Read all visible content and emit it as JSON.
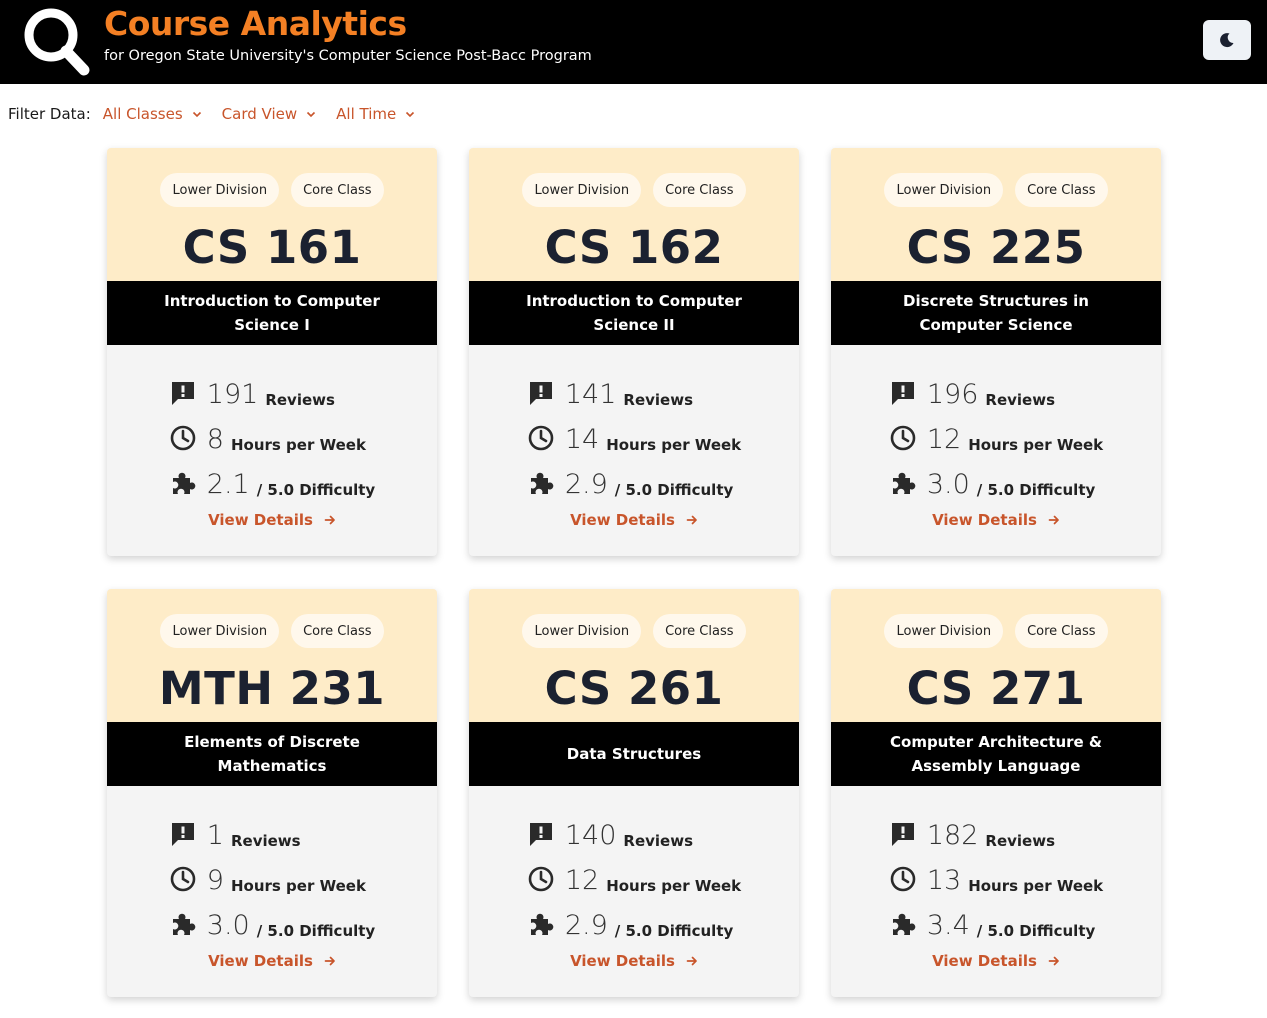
{
  "header": {
    "title": "Course Analytics",
    "subtitle": "for Oregon State University's Computer Science Post-Bacc Program",
    "logo_icon": "search-icon",
    "theme_icon": "moon-icon"
  },
  "filters": {
    "label": "Filter Data:",
    "classes": "All Classes",
    "view": "Card View",
    "time": "All Time"
  },
  "colors": {
    "accent": "#c8552b",
    "title": "#f48024",
    "card_top": "#feecc8",
    "card_body": "#f4f4f4"
  },
  "labels": {
    "reviews": "Reviews",
    "hours": "Hours per Week",
    "difficulty": "/ 5.0 Difficulty",
    "view_details": "View Details"
  },
  "cards": [
    {
      "tags": [
        "Lower Division",
        "Core Class"
      ],
      "code": "CS 161",
      "name": "Introduction to Computer Science I",
      "reviews": "191",
      "hours": "8",
      "difficulty": "2.1"
    },
    {
      "tags": [
        "Lower Division",
        "Core Class"
      ],
      "code": "CS 162",
      "name": "Introduction to Computer Science II",
      "reviews": "141",
      "hours": "14",
      "difficulty": "2.9"
    },
    {
      "tags": [
        "Lower Division",
        "Core Class"
      ],
      "code": "CS 225",
      "name": "Discrete Structures in Computer Science",
      "reviews": "196",
      "hours": "12",
      "difficulty": "3.0"
    },
    {
      "tags": [
        "Lower Division",
        "Core Class"
      ],
      "code": "MTH 231",
      "name": "Elements of Discrete Mathematics",
      "reviews": "1",
      "hours": "9",
      "difficulty": "3.0"
    },
    {
      "tags": [
        "Lower Division",
        "Core Class"
      ],
      "code": "CS 261",
      "name": "Data Structures",
      "reviews": "140",
      "hours": "12",
      "difficulty": "2.9"
    },
    {
      "tags": [
        "Lower Division",
        "Core Class"
      ],
      "code": "CS 271",
      "name": "Computer Architecture & Assembly Language",
      "reviews": "182",
      "hours": "13",
      "difficulty": "3.4"
    }
  ]
}
